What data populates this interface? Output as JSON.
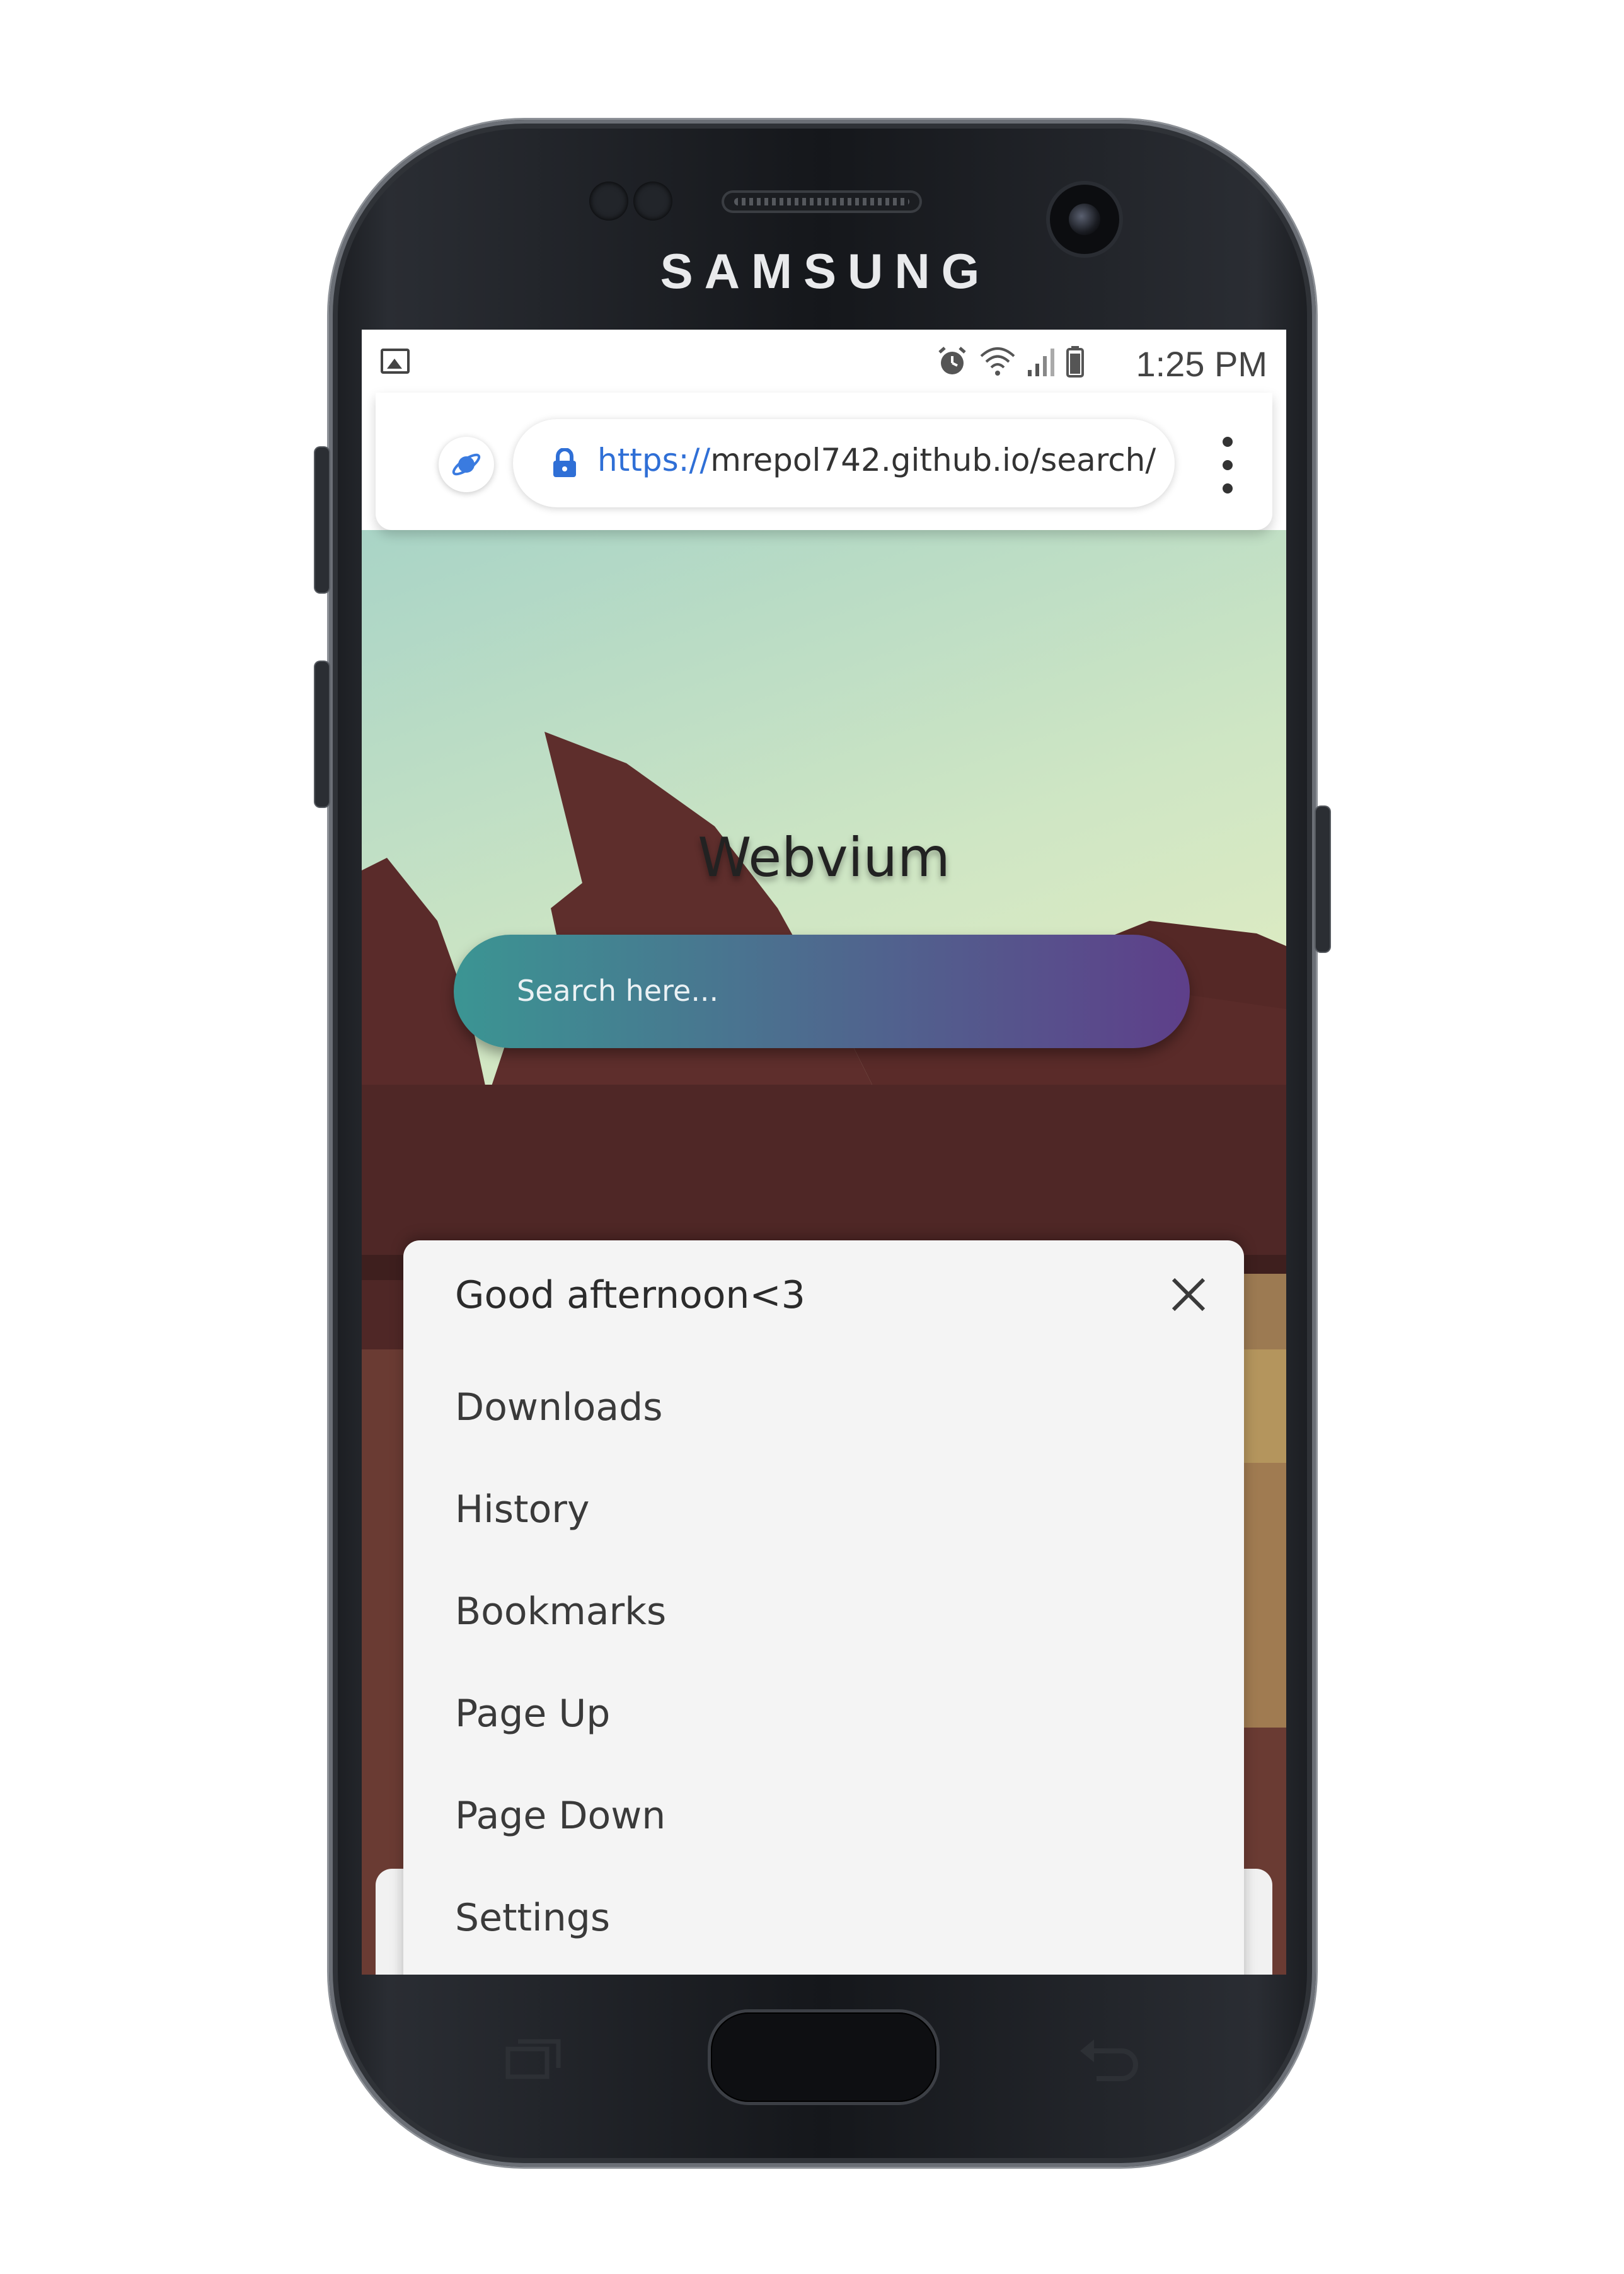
{
  "device": {
    "brand": "SAMSUNG"
  },
  "status_bar": {
    "left_icon": "image-icon",
    "icons": [
      "alarm-icon",
      "wifi-icon",
      "signal-icon",
      "battery-icon"
    ],
    "time": "1:25 PM"
  },
  "address_bar": {
    "site_icon": "webvium-icon",
    "url_scheme": "https://",
    "url_rest": "mrepol742.github.io/search/",
    "lock_icon": "lock-icon",
    "menu_icon": "more-vert-icon",
    "accent_color": "#2f6fd6"
  },
  "page": {
    "title": "Webvium",
    "search_placeholder": "Search here..."
  },
  "menu_sheet": {
    "greeting": "Good afternoon<3",
    "close_icon": "close-icon",
    "items": [
      "Downloads",
      "History",
      "Bookmarks",
      "Page Up",
      "Page Down",
      "Settings"
    ]
  },
  "nav_bar": {
    "icons": [
      "recent-apps-icon",
      "home-button",
      "back-icon"
    ]
  }
}
